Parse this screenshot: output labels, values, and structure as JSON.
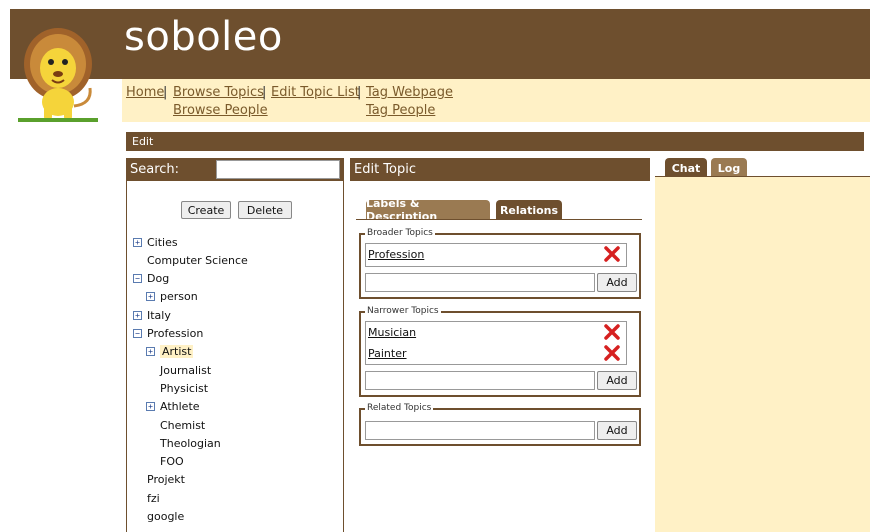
{
  "app": {
    "title": "soboleo"
  },
  "nav": {
    "home": "Home",
    "browse_topics": "Browse Topics",
    "edit_topic_list": "Edit Topic List",
    "tag_webpage": "Tag Webpage",
    "browse_people": "Browse People",
    "tag_people": "Tag People",
    "separator": "|"
  },
  "edit_bar": {
    "label": "Edit"
  },
  "left": {
    "search_label": "Search:",
    "search_value": "",
    "create_label": "Create",
    "delete_label": "Delete",
    "tree": [
      {
        "label": "Cities",
        "toggle": "+",
        "level": 0
      },
      {
        "label": "Computer Science",
        "toggle": "",
        "level": 0
      },
      {
        "label": "Dog",
        "toggle": "-",
        "level": 0
      },
      {
        "label": "person",
        "toggle": "+",
        "level": 1
      },
      {
        "label": "Italy",
        "toggle": "+",
        "level": 0
      },
      {
        "label": "Profession",
        "toggle": "-",
        "level": 0
      },
      {
        "label": "Artist",
        "toggle": "+",
        "level": 1,
        "selected": true
      },
      {
        "label": "Journalist",
        "toggle": "",
        "level": 1
      },
      {
        "label": "Physicist",
        "toggle": "",
        "level": 1
      },
      {
        "label": "Athlete",
        "toggle": "+",
        "level": 1
      },
      {
        "label": "Chemist",
        "toggle": "",
        "level": 1
      },
      {
        "label": "Theologian",
        "toggle": "",
        "level": 1
      },
      {
        "label": "FOO",
        "toggle": "",
        "level": 1
      },
      {
        "label": "Projekt",
        "toggle": "",
        "level": 0
      },
      {
        "label": "fzi",
        "toggle": "",
        "level": 0
      },
      {
        "label": "google",
        "toggle": "",
        "level": 0
      }
    ]
  },
  "edit_topic": {
    "title": "Edit Topic",
    "tabs": [
      {
        "label": "Labels & Description",
        "active": false
      },
      {
        "label": "Relations",
        "active": true
      }
    ],
    "broader": {
      "legend": "Broader Topics",
      "items": [
        "Profession"
      ],
      "input_value": "",
      "add_label": "Add"
    },
    "narrower": {
      "legend": "Narrower Topics",
      "items": [
        "Musician",
        "Painter"
      ],
      "input_value": "",
      "add_label": "Add"
    },
    "related": {
      "legend": "Related Topics",
      "items": [],
      "input_value": "",
      "add_label": "Add"
    }
  },
  "right": {
    "tabs": [
      {
        "label": "Chat",
        "active": true
      },
      {
        "label": "Log",
        "active": false
      }
    ]
  },
  "colors": {
    "brown": "#6e4f2e",
    "cream": "#fff1c6",
    "link": "#7a5a2b",
    "delete_red": "#d62020"
  }
}
